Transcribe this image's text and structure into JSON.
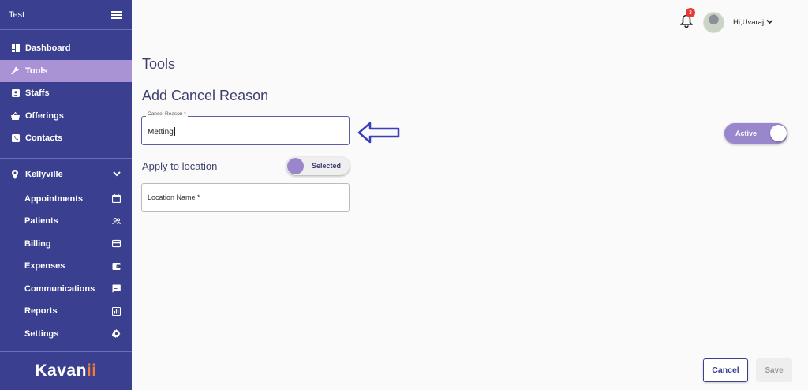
{
  "sidebar": {
    "title": "Test",
    "nav": [
      {
        "label": "Dashboard",
        "icon": "dashboard-icon",
        "active": false
      },
      {
        "label": "Tools",
        "icon": "wrench-icon",
        "active": true
      },
      {
        "label": "Staffs",
        "icon": "staff-badge-icon",
        "active": false
      },
      {
        "label": "Offerings",
        "icon": "basket-icon",
        "active": false
      },
      {
        "label": "Contacts",
        "icon": "contacts-icon",
        "active": false
      }
    ],
    "location": {
      "label": "Kellyville",
      "icon": "location-pin-icon"
    },
    "sub_nav": [
      {
        "label": "Appointments",
        "icon": "calendar-icon"
      },
      {
        "label": "Patients",
        "icon": "people-icon"
      },
      {
        "label": "Billing",
        "icon": "credit-card-icon"
      },
      {
        "label": "Expenses",
        "icon": "wallet-icon"
      },
      {
        "label": "Communications",
        "icon": "chat-icon"
      },
      {
        "label": "Reports",
        "icon": "bar-chart-icon"
      },
      {
        "label": "Settings",
        "icon": "gear-icon"
      }
    ],
    "logo_text": "Kavan",
    "logo_accent": "ii",
    "colors": {
      "background": "#3a3f8f",
      "active": "#a993d4",
      "logo_accent": "#f47b3a"
    }
  },
  "topbar": {
    "notification_count": "3",
    "user_greeting": "Hi,Uvaraj"
  },
  "main": {
    "page_title": "Tools",
    "form_title": "Add Cancel Reason",
    "cancel_reason": {
      "label": "Cancel Reason *",
      "value": "Metting"
    },
    "status_toggle": {
      "label": "Active",
      "on": true
    },
    "apply_location": {
      "label": "Apply to location",
      "toggle_label": "Selected"
    },
    "location_name": {
      "label": "Location Name *",
      "value": ""
    },
    "buttons": {
      "cancel": "Cancel",
      "save": "Save"
    }
  }
}
